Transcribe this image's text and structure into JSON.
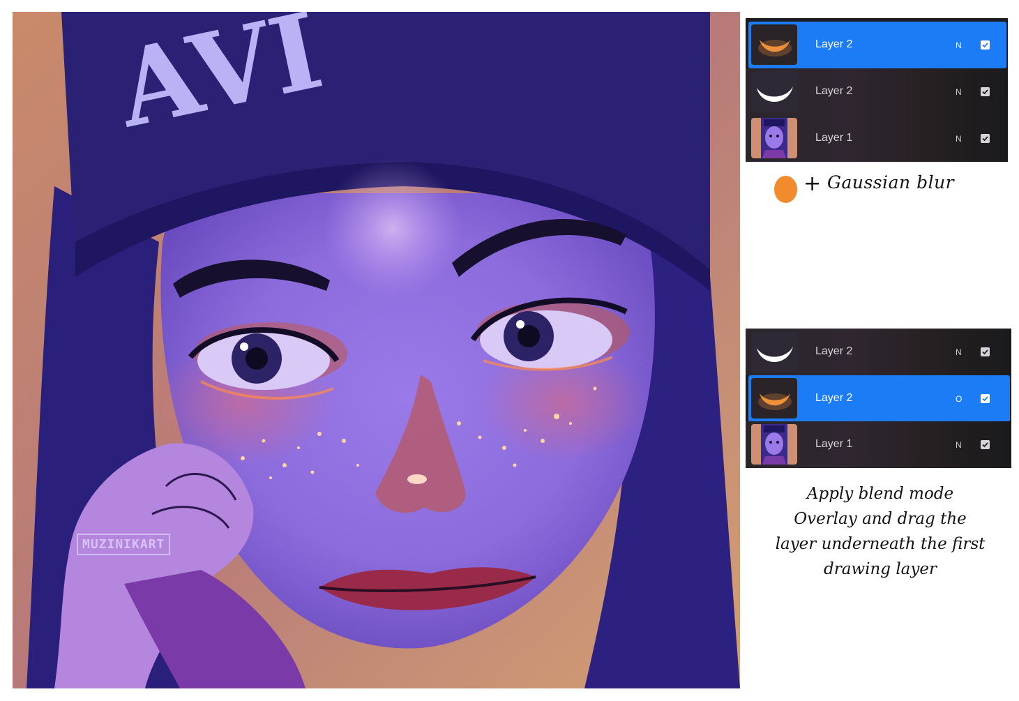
{
  "artwork": {
    "watermark": "MUZINIKART",
    "cap_text": "AVI"
  },
  "panel_top": {
    "layers": [
      {
        "name": "Layer 2",
        "blend": "N",
        "thumb": "orange-crescent-thumbnail",
        "selected": true
      },
      {
        "name": "Layer 2",
        "blend": "N",
        "thumb": "white-crescent-thumbnail",
        "selected": false
      },
      {
        "name": "Layer 1",
        "blend": "N",
        "thumb": "portrait-thumbnail",
        "selected": false
      }
    ]
  },
  "gaussian_note": "Gaussian blur",
  "plus": "+",
  "panel_bottom": {
    "layers": [
      {
        "name": "Layer 2",
        "blend": "N",
        "thumb": "white-crescent-thumbnail",
        "selected": false
      },
      {
        "name": "Layer 2",
        "blend": "O",
        "thumb": "orange-crescent-thumbnail",
        "selected": true
      },
      {
        "name": "Layer 1",
        "blend": "N",
        "thumb": "portrait-thumbnail",
        "selected": false
      }
    ]
  },
  "instructions": [
    "Apply blend mode",
    "Overlay and drag the",
    "layer underneath the first",
    "drawing layer"
  ],
  "colors": {
    "selected_row": "#1c7cf5",
    "panel_bg": "#1c1b1f",
    "glow_orange": "#f28a2e"
  }
}
